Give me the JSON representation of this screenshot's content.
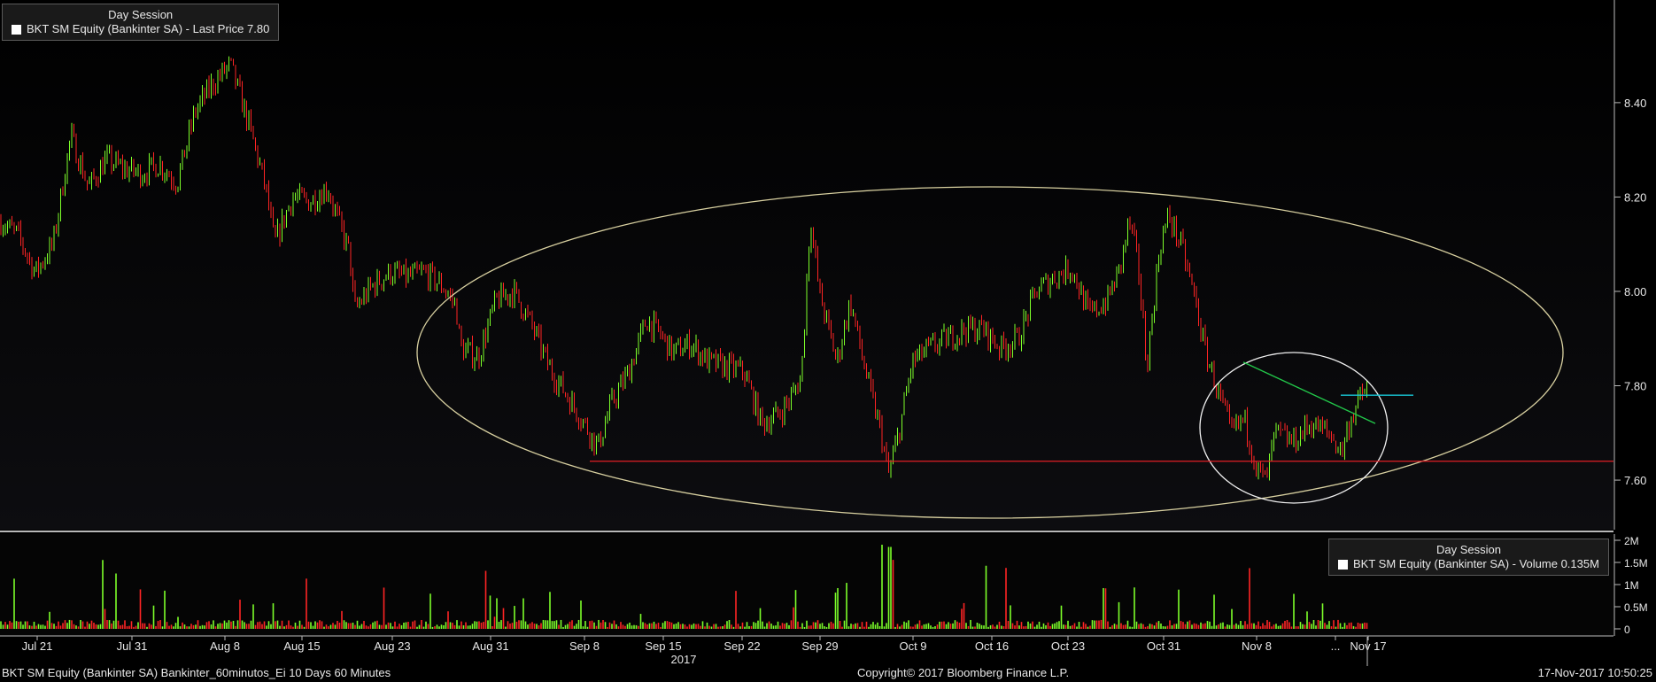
{
  "legend_price": {
    "title": "Day Session",
    "label": "BKT SM Equity (Bankinter SA) - Last Price 7.80"
  },
  "legend_volume": {
    "title": "Day Session",
    "label": "BKT SM Equity (Bankinter SA) - Volume 0.135M"
  },
  "footer": {
    "left": "BKT SM Equity (Bankinter SA) Bankinter_60minutos_Ei 10 Days 60 Minutes",
    "center": "Copyright© 2017 Bloomberg Finance L.P.",
    "right": "17-Nov-2017 10:50:25",
    "year": "2017"
  },
  "colors": {
    "background": "#000000",
    "up": "#7dff2a",
    "down": "#ff2424",
    "support_line": "#e21f26",
    "ellipse_large": "#d8d0a0",
    "ellipse_small": "#f0f0f0",
    "trendline": "#22c84a",
    "breakout_line": "#18c8d8"
  },
  "chart_data": [
    {
      "type": "candlestick",
      "title": "",
      "frequency": "60 Minutes",
      "x_ticks": [
        "Jul 21",
        "Jul 31",
        "Aug 8",
        "Aug 15",
        "Aug 23",
        "Aug 31",
        "Sep 8",
        "Sep 15",
        "Sep 22",
        "Sep 29",
        "Oct 9",
        "Oct 16",
        "Oct 23",
        "Oct 31",
        "Nov 8",
        "...",
        "Nov 17"
      ],
      "y_ticks": [
        "7.60",
        "7.80",
        "8.00",
        "8.20",
        "8.40"
      ],
      "ylim": [
        7.51,
        8.58
      ],
      "last_price": 7.8,
      "close_path": [
        [
          0,
          8.15
        ],
        [
          20,
          8.12
        ],
        [
          40,
          8.04
        ],
        [
          60,
          8.1
        ],
        [
          80,
          8.33
        ],
        [
          100,
          8.22
        ],
        [
          120,
          8.28
        ],
        [
          140,
          8.26
        ],
        [
          160,
          8.25
        ],
        [
          180,
          8.27
        ],
        [
          200,
          8.23
        ],
        [
          220,
          8.38
        ],
        [
          240,
          8.44
        ],
        [
          260,
          8.48
        ],
        [
          280,
          8.36
        ],
        [
          300,
          8.22
        ],
        [
          310,
          8.1
        ],
        [
          330,
          8.2
        ],
        [
          350,
          8.19
        ],
        [
          370,
          8.22
        ],
        [
          380,
          8.16
        ],
        [
          395,
          8.08
        ],
        [
          400,
          7.96
        ],
        [
          420,
          8.01
        ],
        [
          440,
          8.04
        ],
        [
          460,
          8.03
        ],
        [
          480,
          8.04
        ],
        [
          500,
          8.01
        ],
        [
          515,
          7.97
        ],
        [
          520,
          7.88
        ],
        [
          540,
          7.86
        ],
        [
          560,
          7.98
        ],
        [
          580,
          8.0
        ],
        [
          600,
          7.93
        ],
        [
          620,
          7.84
        ],
        [
          640,
          7.78
        ],
        [
          660,
          7.72
        ],
        [
          675,
          7.67
        ],
        [
          690,
          7.76
        ],
        [
          710,
          7.83
        ],
        [
          730,
          7.94
        ],
        [
          745,
          7.91
        ],
        [
          760,
          7.87
        ],
        [
          780,
          7.89
        ],
        [
          800,
          7.85
        ],
        [
          820,
          7.84
        ],
        [
          840,
          7.83
        ],
        [
          860,
          7.72
        ],
        [
          880,
          7.74
        ],
        [
          895,
          7.78
        ],
        [
          905,
          7.82
        ],
        [
          915,
          8.16
        ],
        [
          925,
          8.0
        ],
        [
          945,
          7.85
        ],
        [
          960,
          7.98
        ],
        [
          975,
          7.85
        ],
        [
          985,
          7.77
        ],
        [
          995,
          7.7
        ],
        [
          1003,
          7.61
        ],
        [
          1015,
          7.7
        ],
        [
          1030,
          7.85
        ],
        [
          1050,
          7.88
        ],
        [
          1070,
          7.9
        ],
        [
          1090,
          7.92
        ],
        [
          1110,
          7.92
        ],
        [
          1130,
          7.88
        ],
        [
          1150,
          7.9
        ],
        [
          1170,
          8.0
        ],
        [
          1190,
          8.03
        ],
        [
          1210,
          8.05
        ],
        [
          1230,
          7.95
        ],
        [
          1250,
          7.98
        ],
        [
          1265,
          8.05
        ],
        [
          1275,
          8.15
        ],
        [
          1285,
          8.06
        ],
        [
          1295,
          7.84
        ],
        [
          1310,
          8.1
        ],
        [
          1320,
          8.16
        ],
        [
          1335,
          8.09
        ],
        [
          1350,
          7.98
        ],
        [
          1360,
          7.88
        ],
        [
          1375,
          7.79
        ],
        [
          1390,
          7.7
        ],
        [
          1405,
          7.73
        ],
        [
          1420,
          7.62
        ],
        [
          1430,
          7.6
        ],
        [
          1440,
          7.7
        ],
        [
          1460,
          7.68
        ],
        [
          1480,
          7.72
        ],
        [
          1500,
          7.7
        ],
        [
          1515,
          7.66
        ],
        [
          1525,
          7.73
        ],
        [
          1535,
          7.77
        ],
        [
          1545,
          7.8
        ]
      ]
    },
    {
      "type": "bar",
      "title": "",
      "x_ticks": [
        "Jul 21",
        "Jul 31",
        "Aug 8",
        "Aug 15",
        "Aug 23",
        "Aug 31",
        "Sep 8",
        "Sep 15",
        "Sep 22",
        "Sep 29",
        "Oct 9",
        "Oct 16",
        "Oct 23",
        "Oct 31",
        "Nov 8",
        "...",
        "Nov 17"
      ],
      "y_ticks": [
        "0",
        "0.5M",
        "1M",
        "1.5M",
        "2M"
      ],
      "ylim": [
        0,
        2000000
      ],
      "last_volume": 135000
    }
  ]
}
